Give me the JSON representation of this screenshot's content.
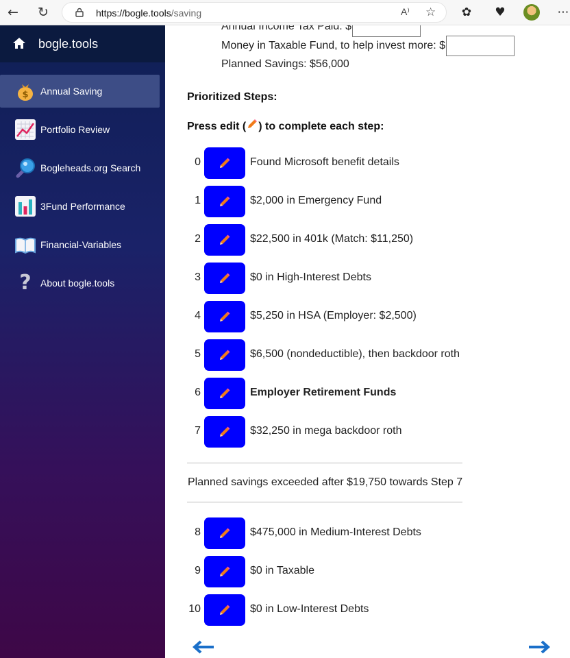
{
  "browser": {
    "url_host": "https://bogle.tools",
    "url_path": "/saving",
    "read_aloud": "A⁾"
  },
  "sidebar": {
    "brand": "bogle.tools",
    "items": [
      {
        "label": "Annual Saving",
        "icon": "money-bag-icon",
        "active": true
      },
      {
        "label": "Portfolio Review",
        "icon": "chart-up-icon",
        "active": false
      },
      {
        "label": "Bogleheads.org Search",
        "icon": "magnifier-icon",
        "active": false
      },
      {
        "label": "3Fund Performance",
        "icon": "bar-chart-icon",
        "active": false
      },
      {
        "label": "Financial-Variables",
        "icon": "open-book-icon",
        "active": false
      },
      {
        "label": "About bogle.tools",
        "icon": "question-icon",
        "active": false
      }
    ]
  },
  "main": {
    "tax_paid_label": "Annual Income Tax Paid: $",
    "taxable_fund_label": "Money in Taxable Fund, to help invest more: $",
    "taxable_fund_value": "",
    "planned_savings": "Planned Savings: $56,000",
    "prioritized_heading": "Prioritized Steps:",
    "press_edit_before": "Press edit (",
    "press_edit_after": ") to complete each step:",
    "steps_before": [
      {
        "num": "0",
        "desc": "Found Microsoft benefit details",
        "bold": false
      },
      {
        "num": "1",
        "desc": "$2,000 in Emergency Fund",
        "bold": false
      },
      {
        "num": "2",
        "desc": "$22,500 in 401k (Match: $11,250)",
        "bold": false
      },
      {
        "num": "3",
        "desc": "$0 in High-Interest Debts",
        "bold": false
      },
      {
        "num": "4",
        "desc": "$5,250 in HSA (Employer: $2,500)",
        "bold": false
      },
      {
        "num": "5",
        "desc": "$6,500 (nondeductible), then backdoor roth",
        "bold": false
      },
      {
        "num": "6",
        "desc": "Employer Retirement Funds",
        "bold": true
      },
      {
        "num": "7",
        "desc": "$32,250 in mega backdoor roth",
        "bold": false
      }
    ],
    "exceeded_notice": "Planned savings exceeded after $19,750 towards Step 7",
    "steps_after": [
      {
        "num": "8",
        "desc": "$475,000 in Medium-Interest Debts",
        "bold": false
      },
      {
        "num": "9",
        "desc": "$0 in Taxable",
        "bold": false
      },
      {
        "num": "10",
        "desc": "$0 in Low-Interest Debts",
        "bold": false
      }
    ]
  },
  "colors": {
    "edit_button": "#0000ff",
    "pencil": "#f07b1a",
    "nav_arrow": "#1a6fc9"
  }
}
